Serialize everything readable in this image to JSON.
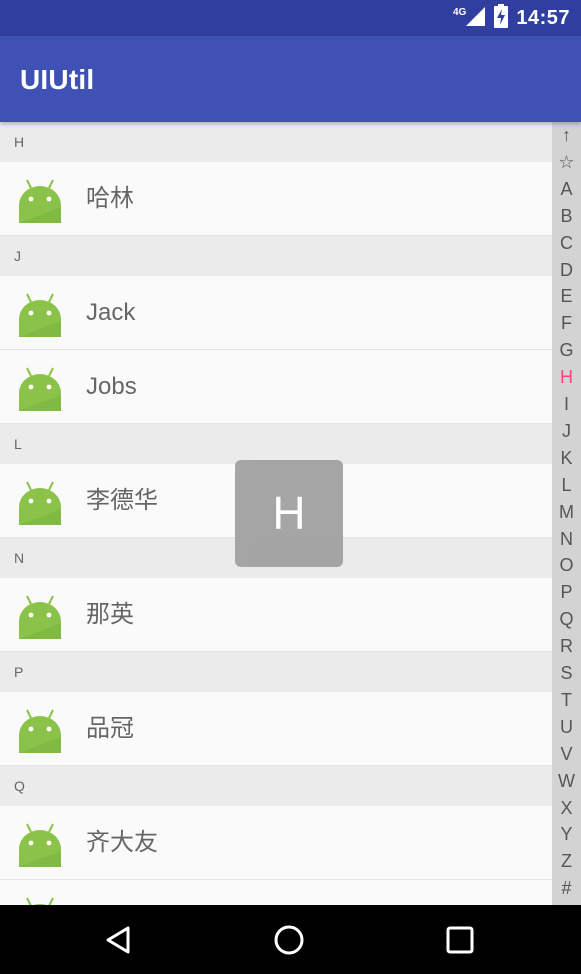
{
  "status_bar": {
    "network": "4G",
    "time": "14:57",
    "icons": [
      "signal-icon",
      "battery-charging-icon"
    ]
  },
  "app_bar": {
    "title": "UIUtil"
  },
  "contacts": [
    {
      "letter": "H",
      "items": [
        {
          "name": "哈林",
          "icon": "android-icon"
        }
      ]
    },
    {
      "letter": "J",
      "items": [
        {
          "name": "Jack",
          "icon": "android-icon"
        },
        {
          "name": "Jobs",
          "icon": "android-icon"
        }
      ]
    },
    {
      "letter": "L",
      "items": [
        {
          "name": "李德华",
          "icon": "android-icon"
        }
      ]
    },
    {
      "letter": "N",
      "items": [
        {
          "name": "那英",
          "icon": "android-icon"
        }
      ]
    },
    {
      "letter": "P",
      "items": [
        {
          "name": "品冠",
          "icon": "android-icon"
        }
      ]
    },
    {
      "letter": "Q",
      "items": [
        {
          "name": "齐大友",
          "icon": "android-icon"
        },
        {
          "name": "",
          "icon": "android-icon"
        }
      ]
    }
  ],
  "index_bar": {
    "letters": [
      "↑",
      "☆",
      "A",
      "B",
      "C",
      "D",
      "E",
      "F",
      "G",
      "H",
      "I",
      "J",
      "K",
      "L",
      "M",
      "N",
      "O",
      "P",
      "Q",
      "R",
      "S",
      "T",
      "U",
      "V",
      "W",
      "X",
      "Y",
      "Z",
      "#"
    ],
    "selected": "H"
  },
  "bubble": {
    "letter": "H"
  },
  "nav_bar": {
    "buttons": [
      "back-icon",
      "home-icon",
      "recents-icon"
    ]
  },
  "colors": {
    "status_bar": "#303f9f",
    "app_bar": "#3f51b5",
    "section_header": "#ebebeb",
    "index_bar": "#d3d3d3",
    "index_selected": "#ff4081",
    "android_green": "#8bc34a"
  }
}
